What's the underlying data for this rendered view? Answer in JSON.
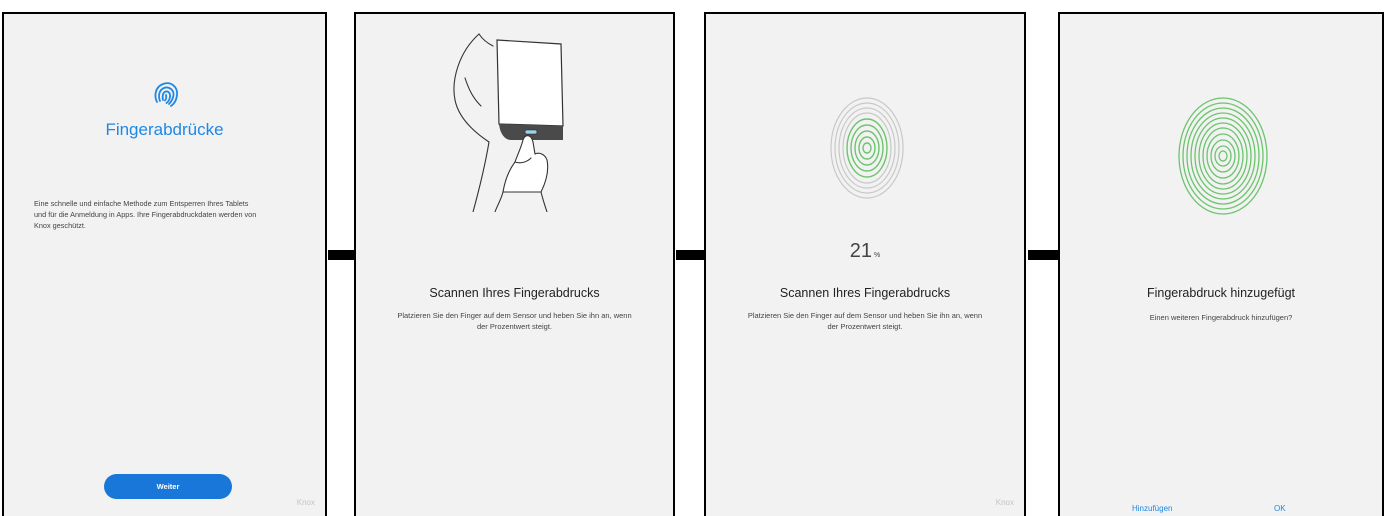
{
  "screens": [
    {
      "title": "Fingerabdrücke",
      "description": "Eine schnelle und einfache Methode zum Entsperren Ihres Tablets und für die Anmeldung in Apps. Ihre Fingerabdruckdaten werden von Knox geschützt.",
      "button": "Weiter",
      "footer": "Knox"
    },
    {
      "title": "Scannen Ihres Fingerabdrucks",
      "instruction": "Platzieren Sie den Finger auf dem Sensor und heben Sie ihn an, wenn der Prozentwert steigt."
    },
    {
      "progress": "21",
      "progress_unit": "%",
      "title": "Scannen Ihres Fingerabdrucks",
      "instruction": "Platzieren Sie den Finger auf dem Sensor und heben Sie ihn an, wenn der Prozentwert steigt.",
      "footer": "Knox"
    },
    {
      "title": "Fingerabdruck hinzugefügt",
      "question": "Einen weiteren Fingerabdruck hinzufügen?",
      "add_button": "Hinzufügen",
      "ok_button": "OK"
    }
  ],
  "colors": {
    "accent": "#1e88e5",
    "button": "#1877d8",
    "fingerprint_green": "#6cc46c",
    "fingerprint_gray": "#c8c8c8",
    "panel_bg": "#f2f2f2"
  },
  "icons": [
    "fingerprint-icon",
    "tablet-hand-illustration",
    "arrow-right-icon"
  ]
}
